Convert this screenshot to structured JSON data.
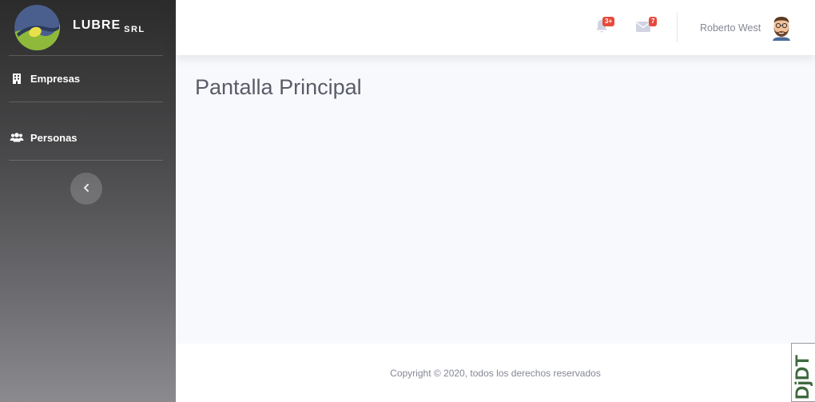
{
  "brand": {
    "name": "LUBRE",
    "suffix": "SRL",
    "colors": {
      "logo_blue": "#4a5f8e",
      "logo_green": "#8fb93a",
      "logo_yellow": "#e8e04a"
    }
  },
  "sidebar": {
    "items": [
      {
        "label": "Empresas",
        "icon": "building-icon"
      },
      {
        "label": "Personas",
        "icon": "users-icon"
      }
    ],
    "toggle_icon": "chevron-left-icon"
  },
  "topbar": {
    "alerts": {
      "icon": "bell-icon",
      "badge": "3+"
    },
    "messages": {
      "icon": "envelope-icon",
      "badge": "7"
    },
    "user": {
      "name": "Roberto West",
      "avatar": "avatar-icon"
    }
  },
  "main": {
    "title": "Pantalla Principal"
  },
  "footer": {
    "copyright": "Copyright © 2020, todos los derechos reservados"
  },
  "debug_toolbar": {
    "label": "DjDT"
  },
  "colors": {
    "badge": "#e74a3b",
    "text_muted": "#858796",
    "title": "#5a5c69",
    "background": "#f8f9fc"
  }
}
